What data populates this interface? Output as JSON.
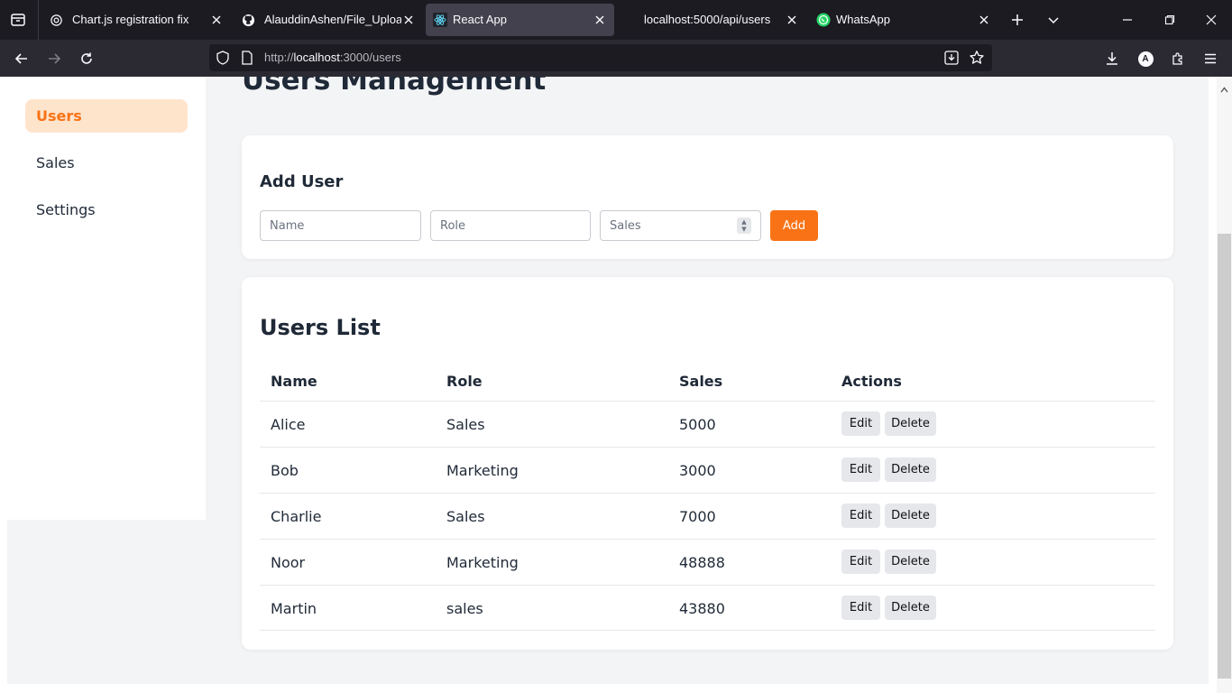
{
  "browser": {
    "tabs": [
      {
        "title": "Chart.js registration fix",
        "favicon": "chatgpt-icon"
      },
      {
        "title": "AlauddinAshen/File_Upload_N",
        "favicon": "github-icon"
      },
      {
        "title": "React App",
        "favicon": "react-icon",
        "active": true
      },
      {
        "title": "localhost:5000/api/users",
        "favicon": "none"
      },
      {
        "title": "WhatsApp",
        "favicon": "whatsapp-icon"
      }
    ],
    "url_prefix": "http://",
    "url_host": "localhost",
    "url_rest": ":3000/users",
    "profile_initial": "A"
  },
  "sidebar": {
    "items": [
      {
        "label": "Users",
        "active": true
      },
      {
        "label": "Sales"
      },
      {
        "label": "Settings"
      }
    ]
  },
  "page": {
    "title": "Users Management"
  },
  "add_user": {
    "heading": "Add User",
    "name_placeholder": "Name",
    "role_placeholder": "Role",
    "sales_placeholder": "Sales",
    "add_label": "Add"
  },
  "users_list": {
    "heading": "Users List",
    "columns": [
      "Name",
      "Role",
      "Sales",
      "Actions"
    ],
    "edit_label": "Edit",
    "delete_label": "Delete",
    "rows": [
      {
        "name": "Alice",
        "role": "Sales",
        "sales": "5000"
      },
      {
        "name": "Bob",
        "role": "Marketing",
        "sales": "3000"
      },
      {
        "name": "Charlie",
        "role": "Sales",
        "sales": "7000"
      },
      {
        "name": "Noor",
        "role": "Marketing",
        "sales": "48888"
      },
      {
        "name": "Martin",
        "role": "sales",
        "sales": "43880"
      }
    ]
  },
  "colors": {
    "accent": "#f97316",
    "active_bg": "#ffe4cc"
  }
}
